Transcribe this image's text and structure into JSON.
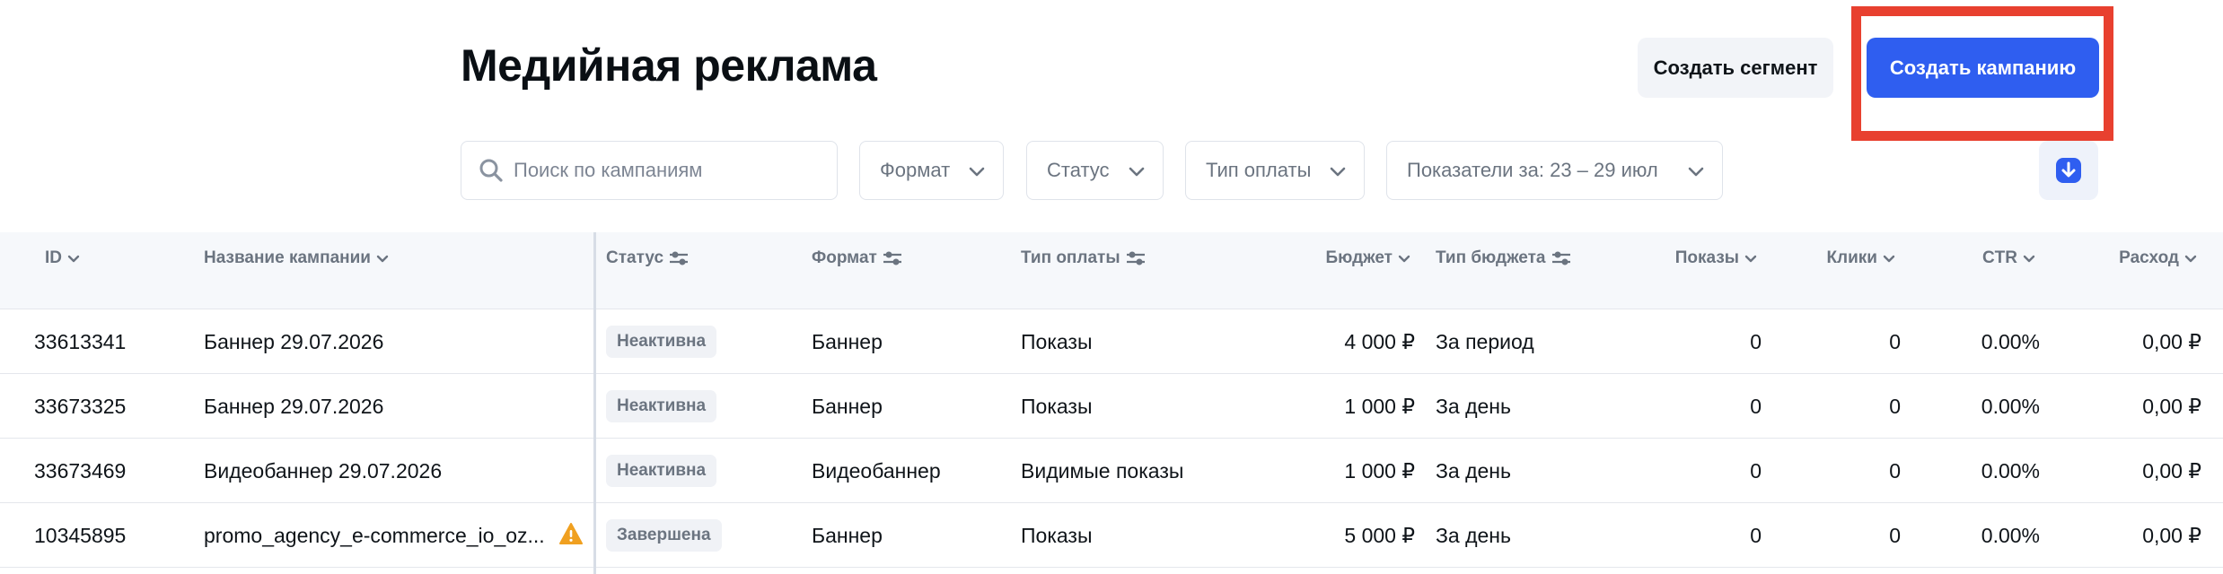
{
  "header": {
    "title": "Медийная реклама",
    "create_segment_label": "Создать сегмент",
    "create_campaign_label": "Создать кампанию"
  },
  "filters": {
    "search_placeholder": "Поиск по кампаниям",
    "format_label": "Формат",
    "status_label": "Статус",
    "payment_type_label": "Тип оплаты",
    "period_label": "Показатели за: 23 – 29 июл"
  },
  "table": {
    "columns": {
      "id": "ID",
      "name": "Название кампании",
      "status": "Статус",
      "format": "Формат",
      "payment": "Тип оплаты",
      "budget": "Бюджет",
      "budget_type": "Тип бюджета",
      "impressions": "Показы",
      "clicks": "Клики",
      "ctr": "CTR",
      "spend": "Расход"
    },
    "rows": [
      {
        "id": "33613341",
        "name": "Баннер 29.07.2026",
        "status": "Неактивна",
        "format": "Баннер",
        "payment": "Показы",
        "budget": "4 000 ₽",
        "budget_type": "За период",
        "impressions": "0",
        "clicks": "0",
        "ctr": "0.00%",
        "spend": "0,00 ₽"
      },
      {
        "id": "33673325",
        "name": "Баннер 29.07.2026",
        "status": "Неактивна",
        "format": "Баннер",
        "payment": "Показы",
        "budget": "1 000 ₽",
        "budget_type": "За день",
        "impressions": "0",
        "clicks": "0",
        "ctr": "0.00%",
        "spend": "0,00 ₽"
      },
      {
        "id": "33673469",
        "name": "Видеобаннер 29.07.2026",
        "status": "Неактивна",
        "format": "Видеобаннер",
        "payment": "Видимые показы",
        "budget": "1 000 ₽",
        "budget_type": "За день",
        "impressions": "0",
        "clicks": "0",
        "ctr": "0.00%",
        "spend": "0,00 ₽"
      },
      {
        "id": "10345895",
        "name": "promo_agency_e-commerce_io_oz...",
        "status": "Завершена",
        "format": "Баннер",
        "payment": "Показы",
        "budget": "5 000 ₽",
        "budget_type": "За день",
        "impressions": "0",
        "clicks": "0",
        "ctr": "0.00%",
        "spend": "0,00 ₽"
      }
    ]
  },
  "colors": {
    "accent": "#2f5ef0",
    "highlight": "#e8402f",
    "warning": "#f0a020"
  },
  "icons": [
    "search-icon",
    "chevron-down-icon",
    "download-icon",
    "sort-chevron-icon",
    "filter-sliders-icon",
    "warning-icon"
  ]
}
